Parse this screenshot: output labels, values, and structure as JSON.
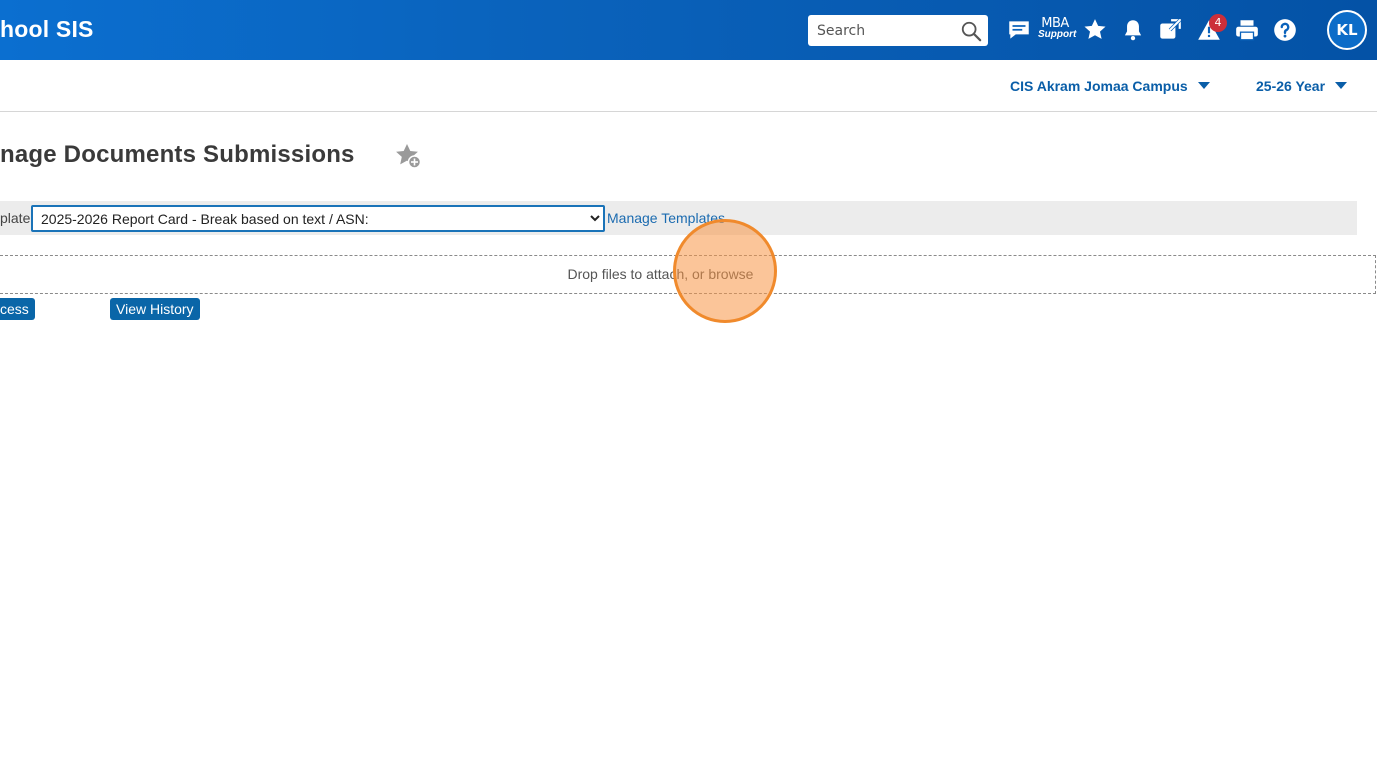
{
  "header": {
    "brand": "hool SIS",
    "search": {
      "placeholder": "Search",
      "value": ""
    },
    "mba_label": "MBA",
    "mba_sub": "Support",
    "alert_count": "4",
    "user_initials": "KL",
    "icons": [
      "search-icon",
      "messages-icon",
      "mba-support-icon",
      "favorites-star-icon",
      "notifications-bell-icon",
      "external-link-icon",
      "alerts-warning-icon",
      "print-icon",
      "help-icon"
    ]
  },
  "context_bar": {
    "campus": "CIS Akram Jomaa Campus",
    "year": "25-26 Year"
  },
  "page": {
    "title": "nage Documents Submissions"
  },
  "template_row": {
    "label": "plate",
    "selected_template": "2025-2026 Report Card - Break based on text / ASN:",
    "manage_link": "Manage Templates"
  },
  "dropzone": {
    "text": "Drop files to attach, or browse"
  },
  "buttons": {
    "process": "cess",
    "view_history": "View History"
  },
  "colors": {
    "header_blue": "#0a62bb",
    "accent_blue": "#0a5ea8",
    "button_blue": "#0a66a8",
    "badge_red": "#cc2f3a",
    "click_marker": "#f08a2c"
  }
}
